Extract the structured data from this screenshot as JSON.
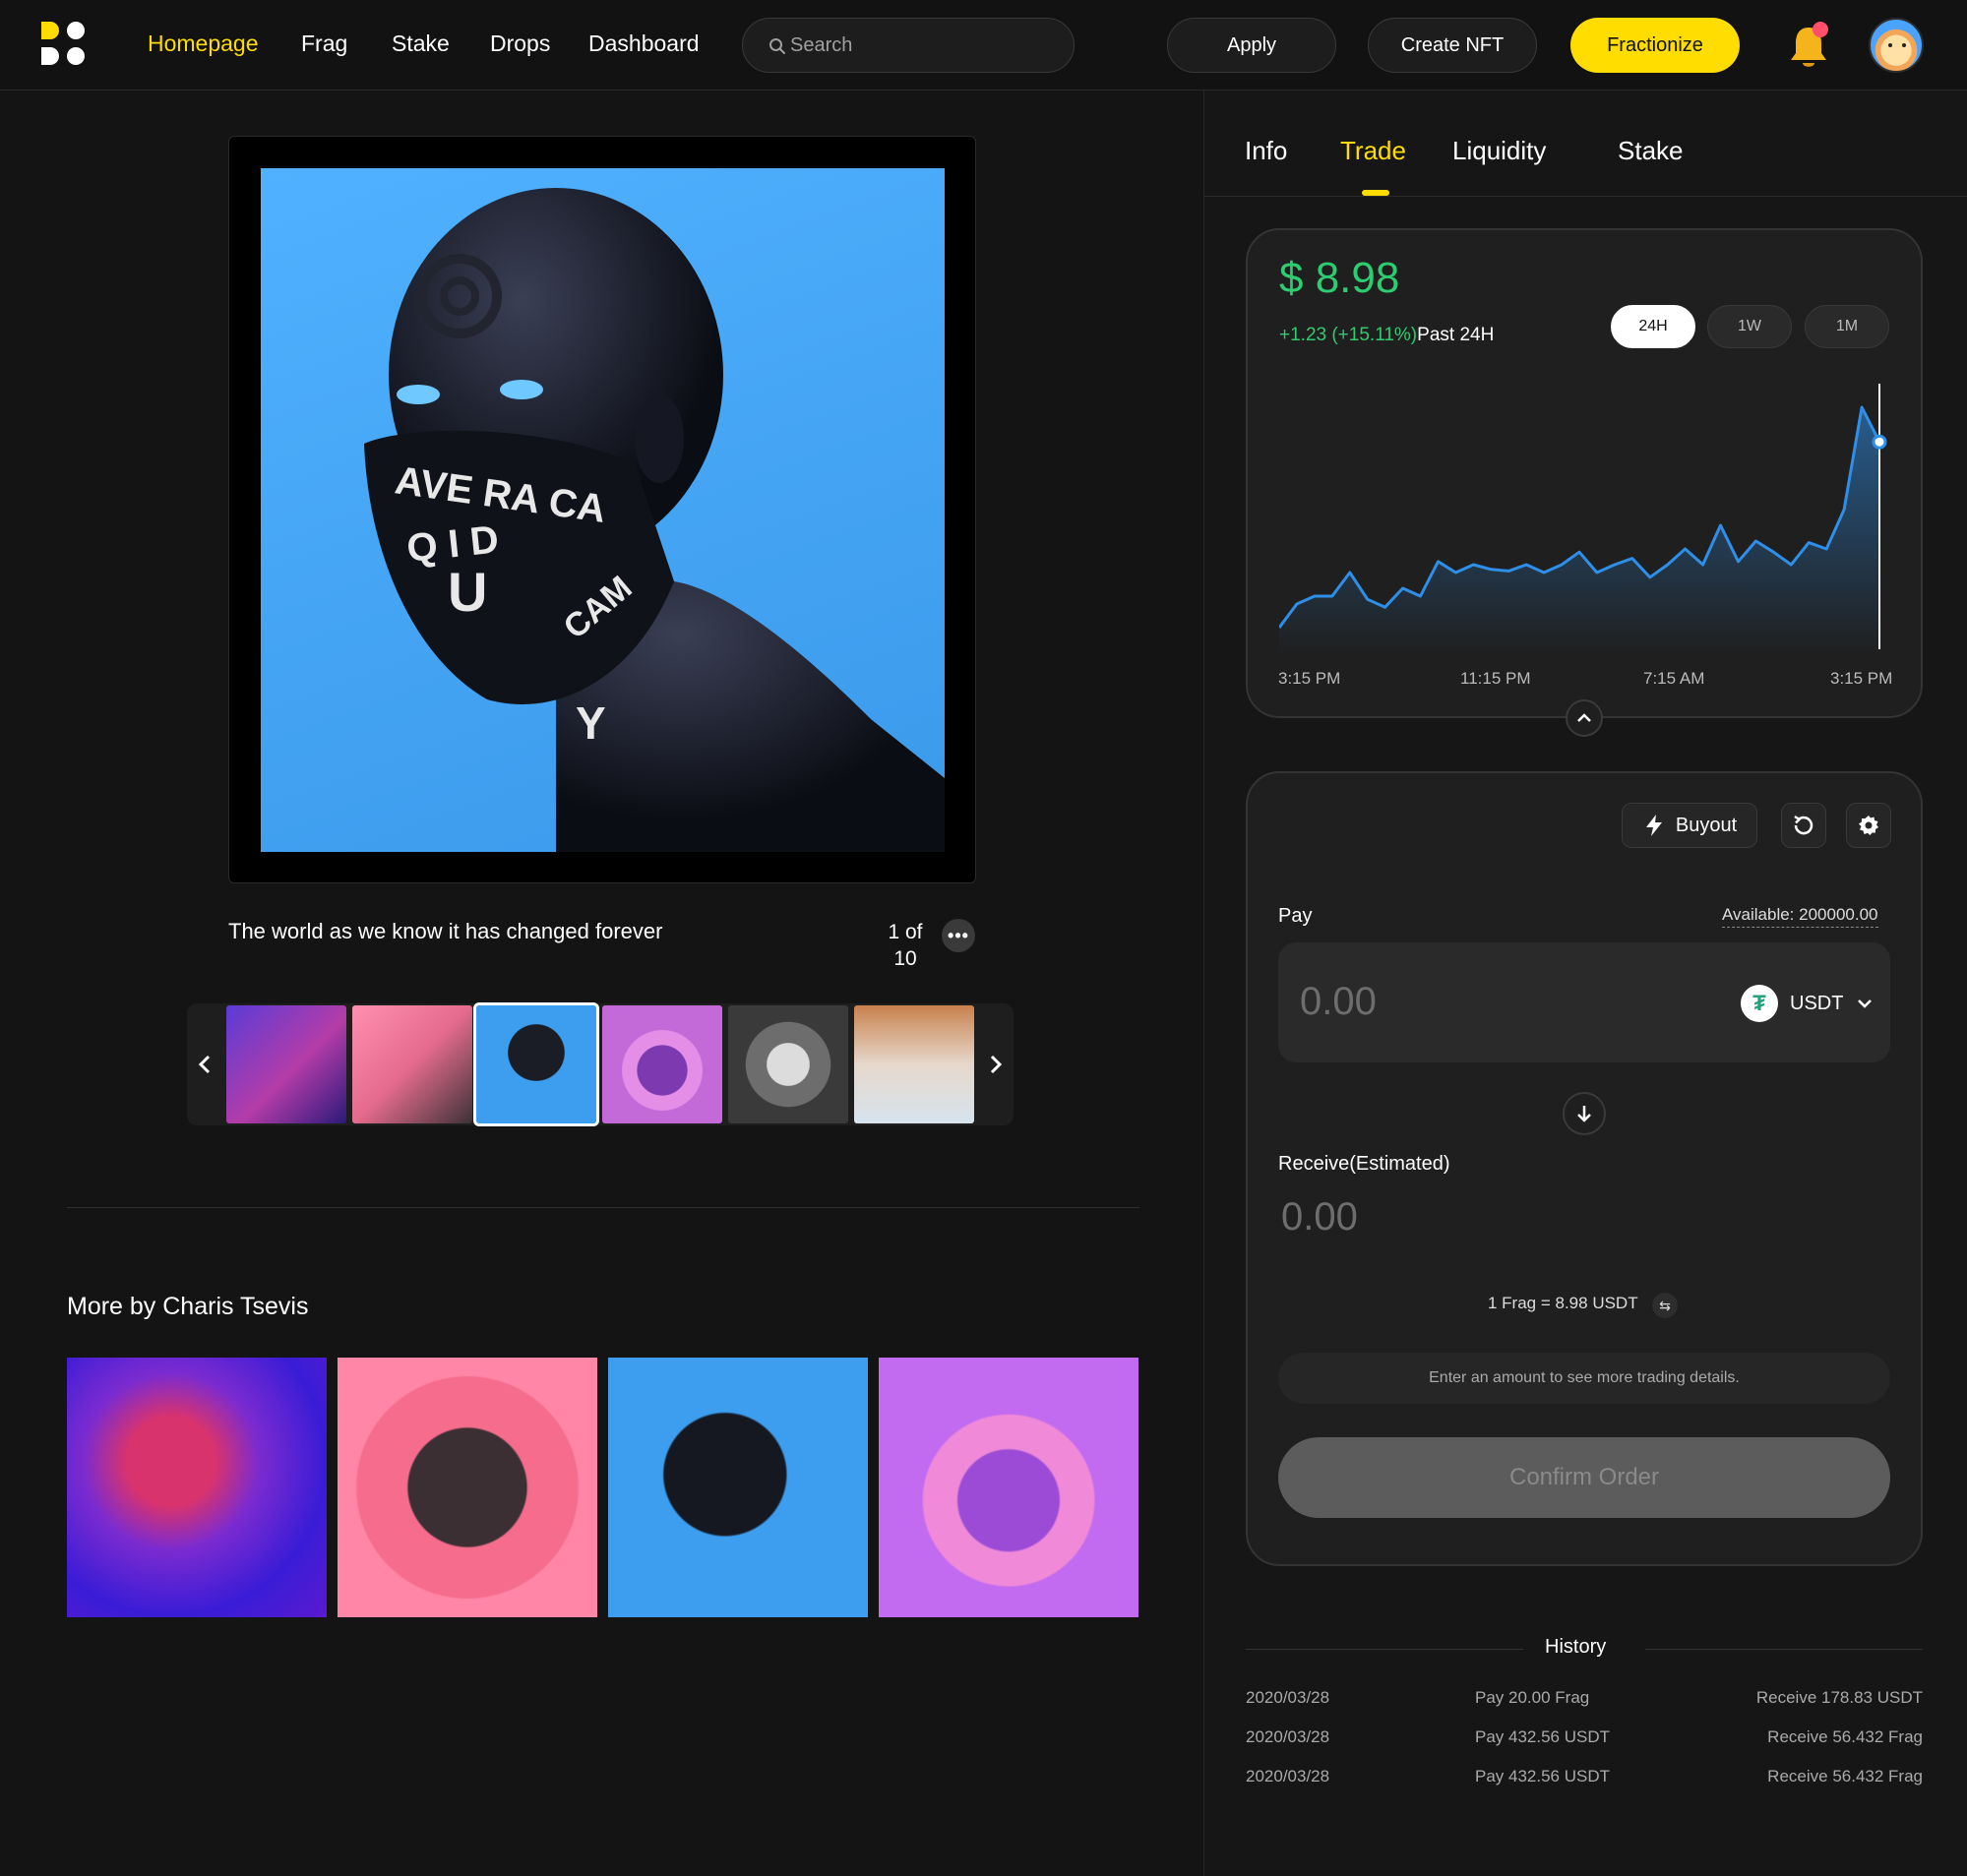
{
  "nav": {
    "items": [
      "Homepage",
      "Frag",
      "Stake",
      "Drops",
      "Dashboard"
    ],
    "active": "Homepage",
    "search_placeholder": "Search",
    "apply_label": "Apply",
    "create_label": "Create NFT",
    "fractionize_label": "Fractionize"
  },
  "artwork": {
    "caption": "The world as we know it has changed forever",
    "counter_current": "1 of",
    "counter_total": "10",
    "more_glyph": "•••"
  },
  "more_by": {
    "title": "More by Charis Tsevis"
  },
  "tabs": [
    "Info",
    "Trade",
    "Liquidity",
    "Stake"
  ],
  "active_tab": "Trade",
  "price_card": {
    "price": "$ 8.98",
    "change": "+1.23  (+15.11%)",
    "period_label": "Past 24H",
    "ranges": [
      "24H",
      "1W",
      "1M"
    ],
    "active_range": "24H",
    "time_labels": [
      "3:15 PM",
      "11:15 PM",
      "7:15 AM",
      "3:15 PM"
    ]
  },
  "trade_card": {
    "buyout_label": "Buyout",
    "pay_label": "Pay",
    "available": "Available:  200000.00",
    "pay_placeholder": "0.00",
    "token": "USDT",
    "token_glyph": "₮",
    "receive_label": "Receive(Estimated)",
    "receive_value": "0.00",
    "rate": "1 Frag = 8.98 USDT",
    "hint": "Enter an amount to see more trading details.",
    "confirm_label": "Confirm Order"
  },
  "history": {
    "title": "History",
    "rows": [
      {
        "date": "2020/03/28",
        "pay": "Pay 20.00 Frag",
        "receive": "Receive 178.83 USDT"
      },
      {
        "date": "2020/03/28",
        "pay": "Pay 432.56 USDT",
        "receive": "Receive 56.432 Frag"
      },
      {
        "date": "2020/03/28",
        "pay": "Pay 432.56 USDT",
        "receive": "Receive 56.432 Frag"
      }
    ]
  },
  "colors": {
    "accent": "#ffdd00",
    "positive": "#2ecc71",
    "chart_line": "#2f8fe8"
  },
  "chart_data": {
    "type": "area",
    "x": [
      "3:15 PM",
      "11:15 PM",
      "7:15 AM",
      "3:15 PM"
    ],
    "values": [
      7.8,
      7.95,
      8.0,
      8.0,
      8.15,
      7.98,
      7.93,
      8.05,
      8.0,
      8.22,
      8.15,
      8.2,
      8.17,
      8.16,
      8.2,
      8.15,
      8.2,
      8.28,
      8.15,
      8.2,
      8.24,
      8.12,
      8.2,
      8.3,
      8.2,
      8.45,
      8.22,
      8.35,
      8.28,
      8.2,
      8.34,
      8.3,
      8.55,
      9.2,
      8.98
    ],
    "title": "",
    "xlabel": "",
    "ylabel": "",
    "grid": false
  }
}
